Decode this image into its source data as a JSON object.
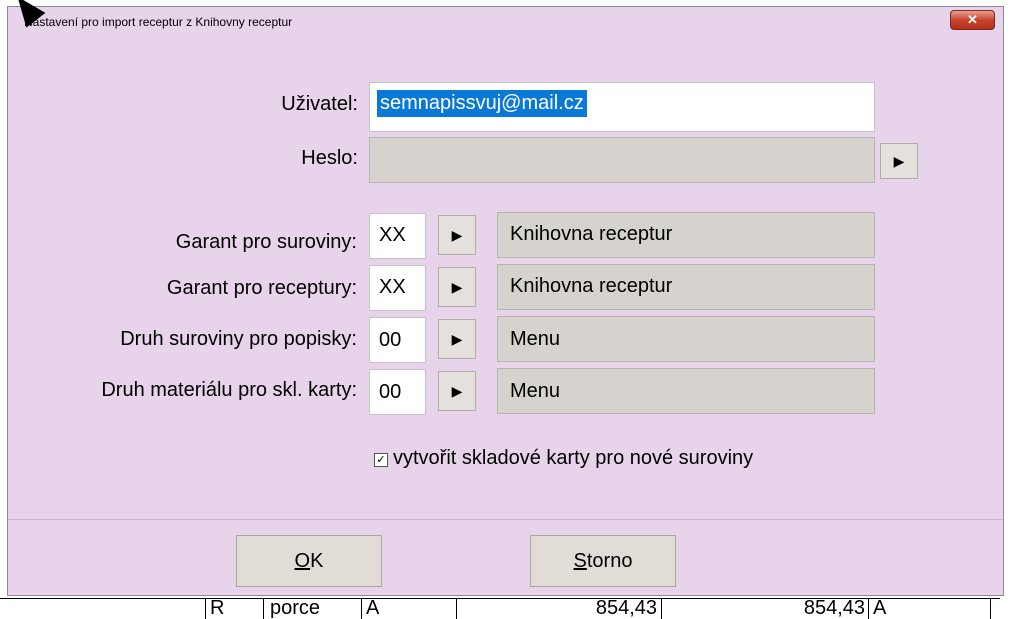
{
  "dialog": {
    "title": "Nastavení pro import receptur z Knihovny receptur",
    "close_glyph": "✕"
  },
  "form": {
    "user_label": "Uživatel:",
    "user_value": "semnapissvuj@mail.cz",
    "password_label": "Heslo:",
    "password_value": "",
    "arrow_glyph": "▶",
    "rows": [
      {
        "label": "Garant pro suroviny:",
        "code": "XX",
        "name": "Knihovna receptur"
      },
      {
        "label": "Garant pro receptury:",
        "code": "XX",
        "name": "Knihovna receptur"
      },
      {
        "label": "Druh suroviny pro popisky:",
        "code": "00",
        "name": "Menu"
      },
      {
        "label": "Druh materiálu pro skl. karty:",
        "code": "00",
        "name": "Menu"
      }
    ],
    "checkbox_label": "vytvořit skladové karty pro nové suroviny",
    "checkbox_glyph": "✓"
  },
  "buttons": {
    "ok_accel": "O",
    "ok_rest": "K",
    "cancel_accel": "S",
    "cancel_rest": "torno"
  },
  "background_row": {
    "c1": "R",
    "c2": "porce",
    "c3": "A",
    "c4": "854,43",
    "c5": "854,43",
    "c6": "A"
  }
}
